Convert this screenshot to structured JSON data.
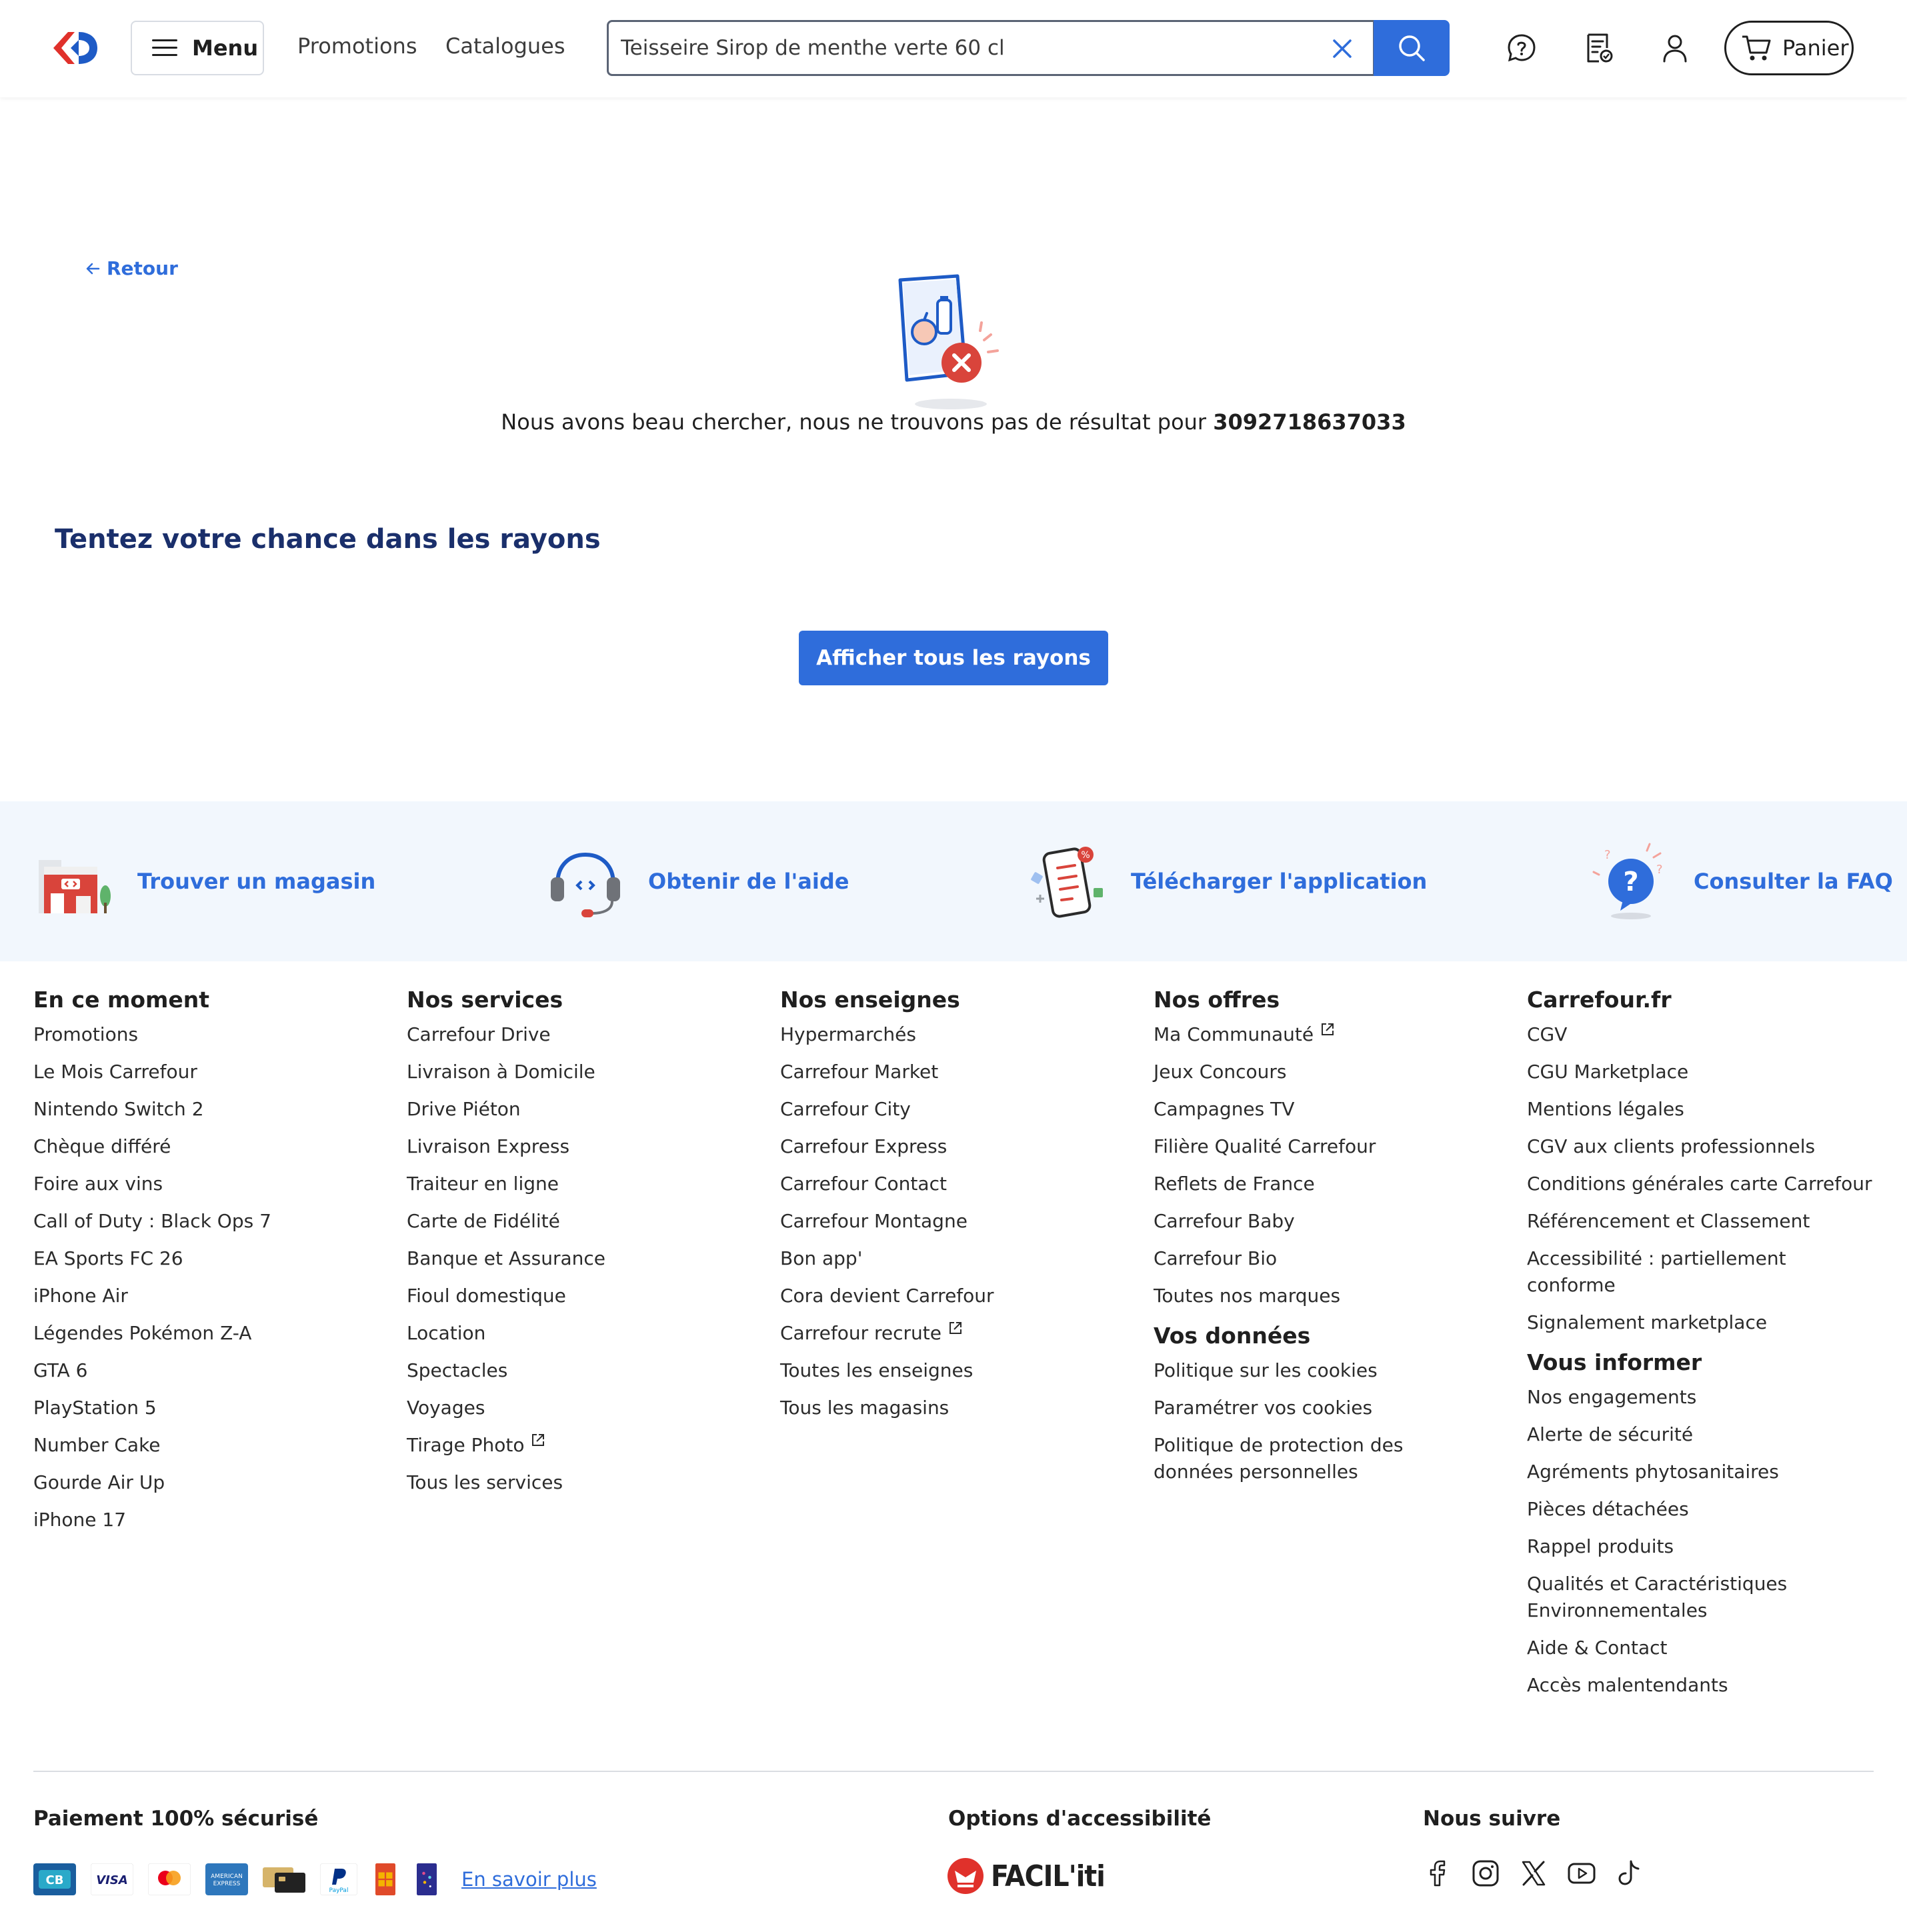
{
  "header": {
    "menu_label": "Menu",
    "nav": [
      "Promotions",
      "Catalogues"
    ],
    "search": {
      "value": "Teisseire Sirop de menthe verte 60 cl"
    },
    "cart_label": "Panier"
  },
  "main": {
    "back_label": "Retour",
    "empty_message": "Nous avons beau chercher, nous ne trouvons pas de résultat pour",
    "empty_query": "3092718637033",
    "section_title": "Tentez votre chance dans les rayons",
    "cta_label": "Afficher tous les rayons"
  },
  "services": [
    {
      "label": "Trouver un magasin",
      "icon": "store-icon"
    },
    {
      "label": "Obtenir de l'aide",
      "icon": "headset-icon"
    },
    {
      "label": "Télécharger l'application",
      "icon": "phone-app-icon"
    },
    {
      "label": "Consulter la FAQ",
      "icon": "faq-icon"
    }
  ],
  "footer": {
    "col1": {
      "title": "En ce moment",
      "links": [
        "Promotions",
        "Le Mois Carrefour",
        "Nintendo Switch 2",
        "Chèque différé",
        "Foire aux vins",
        "Call of Duty : Black Ops 7",
        "EA Sports FC 26",
        "iPhone Air",
        "Légendes Pokémon Z-A",
        "GTA 6",
        "PlayStation 5",
        "Number Cake",
        "Gourde Air Up",
        "iPhone 17"
      ]
    },
    "col2": {
      "title": "Nos services",
      "links": [
        "Carrefour Drive",
        "Livraison à Domicile",
        "Drive Piéton",
        "Livraison Express",
        "Traiteur en ligne",
        "Carte de Fidélité",
        "Banque et Assurance",
        "Fioul domestique",
        "Location",
        "Spectacles",
        "Voyages",
        "Tirage Photo",
        "Tous les services"
      ]
    },
    "col3": {
      "title": "Nos enseignes",
      "links": [
        "Hypermarchés",
        "Carrefour Market",
        "Carrefour City",
        "Carrefour Express",
        "Carrefour Contact",
        "Carrefour Montagne",
        "Bon app'",
        "Cora devient Carrefour",
        "Carrefour recrute",
        "Toutes les enseignes",
        "Tous les magasins"
      ]
    },
    "col4": {
      "title": "Nos offres",
      "links": [
        "Ma Communauté",
        "Jeux Concours",
        "Campagnes TV",
        "Filière Qualité Carrefour",
        "Reflets de France",
        "Carrefour Baby",
        "Carrefour Bio",
        "Toutes nos marques"
      ],
      "title2": "Vos données",
      "links2": [
        "Politique sur les cookies",
        "Paramétrer vos cookies",
        "Politique de protection des données personnelles"
      ]
    },
    "col5": {
      "title": "Carrefour.fr",
      "links": [
        "CGV",
        "CGU Marketplace",
        "Mentions légales",
        "CGV aux clients professionnels",
        "Conditions générales carte Carrefour",
        "Référencement et Classement",
        "Accessibilité : partiellement conforme",
        "Signalement marketplace"
      ],
      "title2": "Vous informer",
      "links2": [
        "Nos engagements",
        "Alerte de sécurité",
        "Agréments phytosanitaires",
        "Pièces détachées",
        "Rappel produits",
        "Qualités et Caractéristiques Environnementales",
        "Aide & Contact",
        "Accès malentendants"
      ]
    }
  },
  "bottom": {
    "payment_title": "Paiement 100% sécurisé",
    "payment_methods": [
      "CB",
      "VISA",
      "Mastercard",
      "American Express",
      "Carte Pass",
      "PayPal",
      "Carte cadeau",
      "Illicado"
    ],
    "learn_more": "En savoir plus",
    "accessibility_title": "Options d'accessibilité",
    "facil_word": "FACIL'iti",
    "follow_title": "Nous suivre",
    "social": [
      "facebook-icon",
      "instagram-icon",
      "x-icon",
      "youtube-icon",
      "tiktok-icon"
    ]
  },
  "colors": {
    "accent": "#2f6ddb",
    "title_navy": "#1a2f6b",
    "band_bg": "#f2f7fd",
    "brand_red": "#e0312b"
  }
}
